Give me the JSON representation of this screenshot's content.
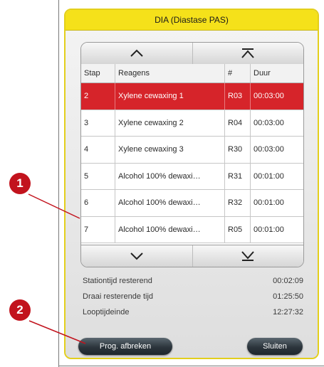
{
  "dialog": {
    "title": "DIA (Diastase PAS)"
  },
  "table": {
    "columns": [
      "Stap",
      "Reagens",
      "#",
      "Duur"
    ],
    "rows": [
      {
        "step": "2",
        "reagent": "Xylene cewaxing 1",
        "station": "R03",
        "duration": "00:03:00",
        "selected": true
      },
      {
        "step": "3",
        "reagent": "Xylene cewaxing 2",
        "station": "R04",
        "duration": "00:03:00",
        "selected": false
      },
      {
        "step": "4",
        "reagent": "Xylene cewaxing 3",
        "station": "R30",
        "duration": "00:03:00",
        "selected": false
      },
      {
        "step": "5",
        "reagent": "Alcohol 100% dewaxi…",
        "station": "R31",
        "duration": "00:01:00",
        "selected": false
      },
      {
        "step": "6",
        "reagent": "Alcohol 100% dewaxi…",
        "station": "R32",
        "duration": "00:01:00",
        "selected": false
      },
      {
        "step": "7",
        "reagent": "Alcohol 100% dewaxi…",
        "station": "R05",
        "duration": "00:01:00",
        "selected": false
      }
    ],
    "selected_color": "#d6242a"
  },
  "scroll": {
    "up_icon": "chevron-up-icon",
    "top_icon": "scroll-to-top-icon",
    "down_icon": "chevron-down-icon",
    "bottom_icon": "scroll-to-bottom-icon"
  },
  "info": {
    "station_time_label": "Stationtijd resterend",
    "station_time_value": "00:02:09",
    "run_time_label": "Draai resterende tijd",
    "run_time_value": "01:25:50",
    "end_label": "Looptijdeinde",
    "end_value": "12:27:32"
  },
  "buttons": {
    "abort_label": "Prog. afbreken",
    "close_label": "Sluiten"
  },
  "callouts": {
    "one": "1",
    "two": "2",
    "color": "#c2131d"
  },
  "accent_color": "#f5e11a"
}
